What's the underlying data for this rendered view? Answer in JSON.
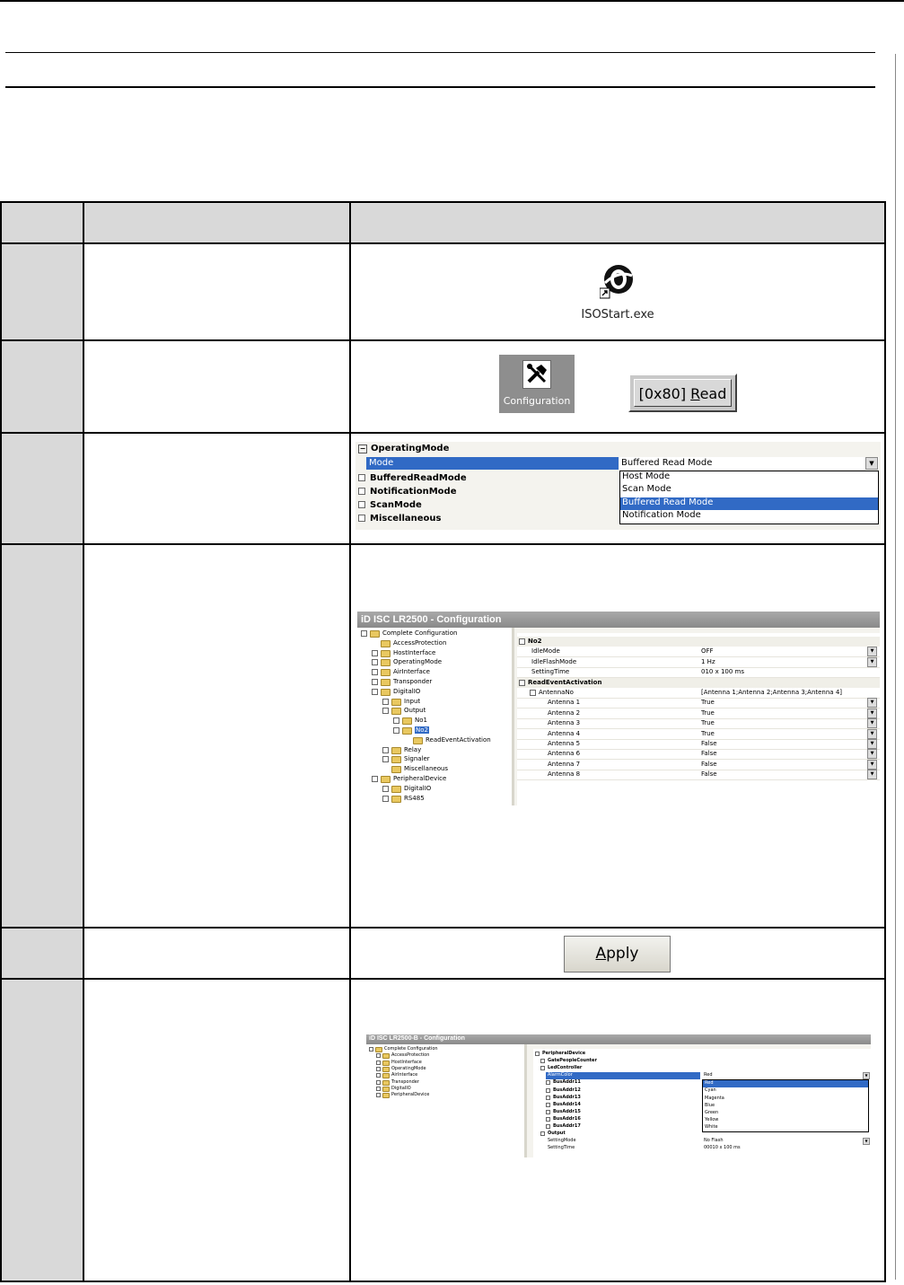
{
  "step1": {
    "shortcut_label": "ISOStart.exe"
  },
  "step2": {
    "configuration_label": "Configuration",
    "read_button_prefix": "[0x80] ",
    "read_button_accel": "R",
    "read_button_rest": "ead"
  },
  "step3": {
    "root": "OperatingMode",
    "mode_label": "Mode",
    "mode_value": "Buffered Read Mode",
    "children": [
      "BufferedReadMode",
      "NotificationMode",
      "ScanMode",
      "Miscellaneous"
    ],
    "options": [
      "Host Mode",
      "Scan Mode",
      "Buffered Read Mode",
      "Notification Mode"
    ]
  },
  "step4": {
    "title": "iD ISC LR2500 - Configuration",
    "tree": [
      "Complete Configuration",
      "AccessProtection",
      "HostInterface",
      "OperatingMode",
      "AirInterface",
      "Transponder",
      "DigitalIO",
      "Input",
      "Output",
      "No1",
      "No2",
      "ReadEventActivation",
      "Relay",
      "Signaler",
      "Miscellaneous",
      "PeripheralDevice",
      "DigitalIO",
      "RS485"
    ],
    "group": "No2",
    "props": [
      {
        "name": "IdleMode",
        "value": "OFF"
      },
      {
        "name": "IdleFlashMode",
        "value": "1 Hz"
      },
      {
        "name": "SettingTime",
        "value": "010 x 100 ms"
      }
    ],
    "subgroup": "ReadEventActivation",
    "antenna_no": {
      "name": "AntennaNo",
      "value": "[Antenna 1;Antenna 2;Antenna 3;Antenna 4]"
    },
    "antennas": [
      {
        "name": "Antenna 1",
        "value": "True"
      },
      {
        "name": "Antenna 2",
        "value": "True"
      },
      {
        "name": "Antenna 3",
        "value": "True"
      },
      {
        "name": "Antenna 4",
        "value": "True"
      },
      {
        "name": "Antenna 5",
        "value": "False"
      },
      {
        "name": "Antenna 6",
        "value": "False"
      },
      {
        "name": "Antenna 7",
        "value": "False"
      },
      {
        "name": "Antenna 8",
        "value": "False"
      }
    ]
  },
  "step5": {
    "apply_accel": "A",
    "apply_rest": "pply"
  },
  "step6": {
    "title": "iD ISC LR2500-B - Configuration",
    "tree": [
      "Complete Configuration",
      "AccessProtection",
      "HostInterface",
      "OperatingMode",
      "AirInterface",
      "Transponder",
      "DigitalIO",
      "PeripheralDevice"
    ],
    "groups": [
      "PeripheralDevice",
      "GatePeopleCounter",
      "LedController"
    ],
    "selected_prop": "AlarmColor",
    "selected_value": "Red",
    "bus_addrs": [
      "BusAddr11",
      "BusAddr12",
      "BusAddr13",
      "BusAddr14",
      "BusAddr15",
      "BusAddr16",
      "BusAddr17"
    ],
    "colors": [
      "Red",
      "Cyan",
      "Magenta",
      "Blue",
      "Green",
      "Yellow",
      "White"
    ],
    "output_group": "Output",
    "output_props": [
      {
        "name": "SettingMode",
        "value": "No Flash"
      },
      {
        "name": "SettingTime",
        "value": "00010 x 100 ms"
      }
    ]
  }
}
